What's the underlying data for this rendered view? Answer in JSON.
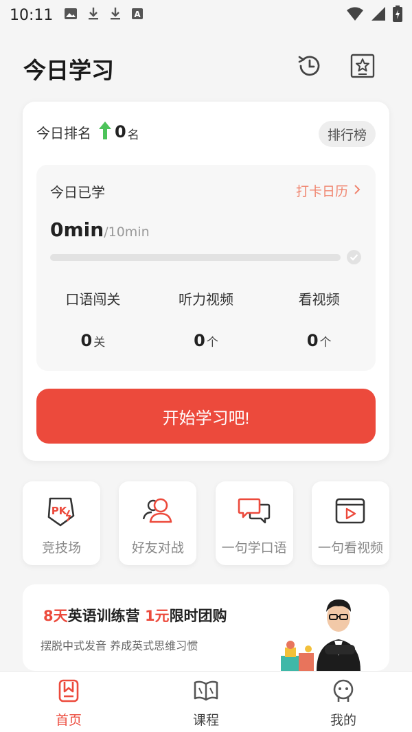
{
  "status_bar": {
    "time": "10:11",
    "left_icons": [
      "image-icon",
      "download-icon",
      "download-icon",
      "a-icon"
    ],
    "right_icons": [
      "wifi-icon",
      "signal-icon",
      "battery-icon"
    ]
  },
  "header": {
    "title": "今日学习",
    "history_icon": "history-clock-icon",
    "favorites_icon": "star-square-icon"
  },
  "ranking": {
    "label": "今日排名",
    "value": "0",
    "unit": "名",
    "leaderboard_label": "排行榜",
    "arrow_color": "#4cc35a"
  },
  "study": {
    "label": "今日已学",
    "calendar_link": "打卡日历",
    "minutes_value": "0min",
    "minutes_goal": "/10min",
    "progress": 0,
    "stats": [
      {
        "label": "口语闯关",
        "value": "0",
        "unit": "关"
      },
      {
        "label": "听力视频",
        "value": "0",
        "unit": "个"
      },
      {
        "label": "看视频",
        "value": "0",
        "unit": "个"
      }
    ]
  },
  "start_button": "开始学习吧!",
  "features": [
    {
      "label": "竞技场",
      "icon": "pk-shield-icon"
    },
    {
      "label": "好友对战",
      "icon": "friends-icon"
    },
    {
      "label": "一句学口语",
      "icon": "chat-bubbles-icon"
    },
    {
      "label": "一句看视频",
      "icon": "video-play-icon"
    }
  ],
  "promo": {
    "title_part1": "8天",
    "title_part2": "英语训练营 ",
    "title_part3": "1元",
    "title_part4": "限时团购",
    "subtitle": "摆脱中式发音 养成英式思维习惯"
  },
  "tabbar": [
    {
      "label": "首页",
      "icon": "home-bookmark-icon",
      "active": true
    },
    {
      "label": "课程",
      "icon": "open-book-icon",
      "active": false
    },
    {
      "label": "我的",
      "icon": "person-face-icon",
      "active": false
    }
  ],
  "colors": {
    "accent": "#ec4a3c",
    "link": "#f0856f",
    "background": "#f5f5f5"
  }
}
